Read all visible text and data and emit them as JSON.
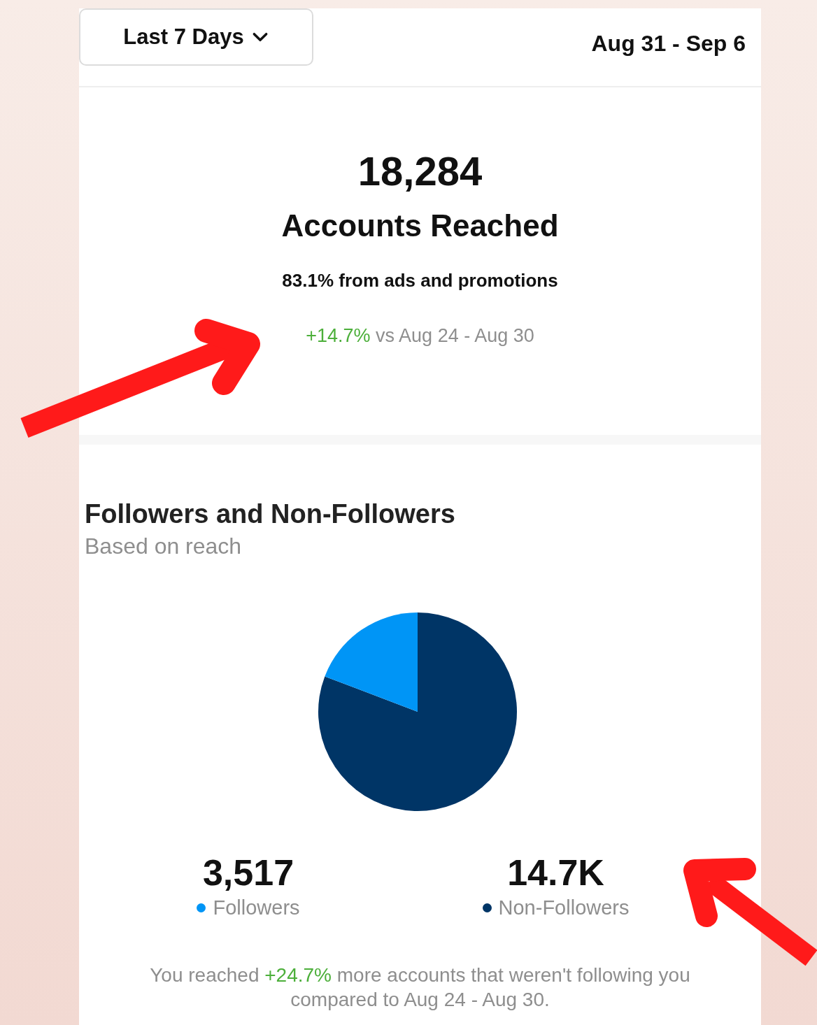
{
  "header": {
    "range_button": "Last 7 Days",
    "date_range": "Aug 31 - Sep 6"
  },
  "reach": {
    "total": "18,284",
    "label": "Accounts Reached",
    "ads_share": "83.1% from ads and promotions",
    "change": "+14.7%",
    "comparison": "vs Aug 24 - Aug 30"
  },
  "audience": {
    "title": "Followers and Non-Followers",
    "subtitle": "Based on reach",
    "chart_data": {
      "type": "pie",
      "categories": [
        "Followers",
        "Non-Followers"
      ],
      "series": [
        {
          "values": [
            19.2,
            80.8
          ]
        }
      ]
    },
    "stats": [
      {
        "value": "3,517",
        "color": "#0095f6"
      },
      {
        "value": "14.7K",
        "color": "#003566"
      }
    ],
    "summary": "You reached **+24.7%** more accounts that weren't following you compared to Aug 24 - Aug 30."
  }
}
